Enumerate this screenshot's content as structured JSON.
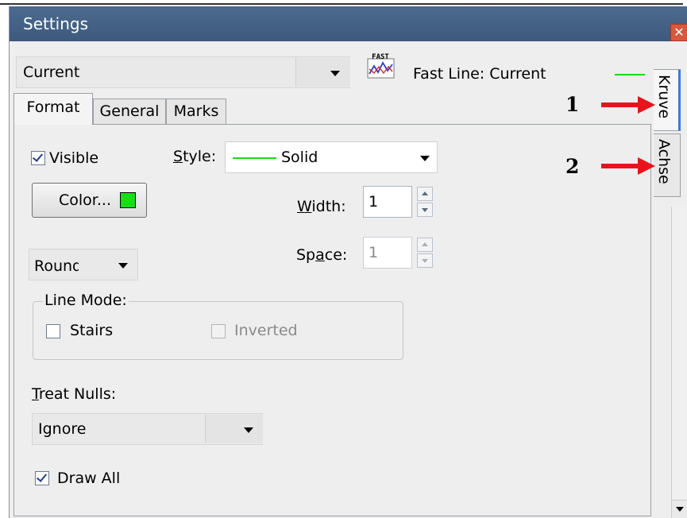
{
  "window": {
    "title": "Settings",
    "close_glyph": "✕"
  },
  "series_select": {
    "value": "Current"
  },
  "series_info": {
    "icon_text": "FAST",
    "label": "Fast Line: Current",
    "line_color": "#12e012"
  },
  "tabs": [
    {
      "label": "Format",
      "active": true
    },
    {
      "label": "General",
      "active": false
    },
    {
      "label": "Marks",
      "active": false
    }
  ],
  "format": {
    "visible_label": "Visible",
    "visible_checked": true,
    "style_label_pre": "",
    "style_label_u": "S",
    "style_label_post": "tyle:",
    "style_value": "Solid",
    "color_button_label": "Color...",
    "color_value": "#12e012",
    "width_label_u": "W",
    "width_label_post": "idth:",
    "width_value": "1",
    "space_label_pre": "Sp",
    "space_label_u": "a",
    "space_label_post": "ce:",
    "space_value": "1",
    "join_value": "Round",
    "line_mode_label": "Line Mode:",
    "stairs_label": "Stairs",
    "stairs_checked": false,
    "inverted_label": "Inverted",
    "inverted_checked": false,
    "treat_nulls_label_u": "T",
    "treat_nulls_label_post": "reat Nulls:",
    "treat_nulls_value": "Ignore",
    "draw_all_label": "Draw All",
    "draw_all_checked": true
  },
  "side_tabs": [
    {
      "label": "Kruve",
      "active": true
    },
    {
      "label": "Achse",
      "active": false
    }
  ],
  "annotations": [
    {
      "number": "1",
      "color": "#e8141c"
    },
    {
      "number": "2",
      "color": "#e8141c"
    }
  ]
}
